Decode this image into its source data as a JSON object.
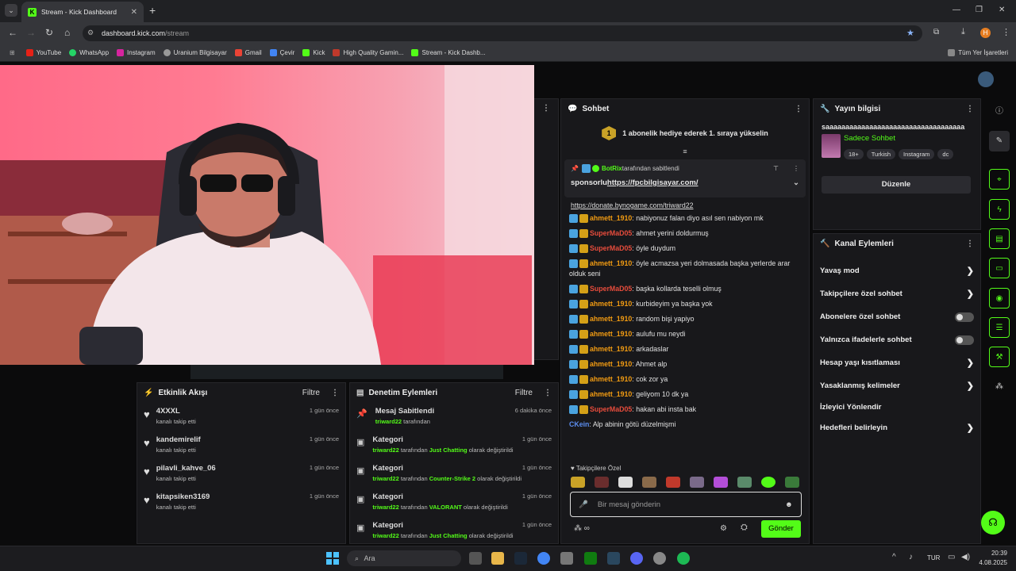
{
  "browser": {
    "tab_title": "Stream - Kick Dashboard",
    "url_host": "dashboard.kick.com",
    "url_path": "/stream",
    "bookmarks": [
      "YouTube",
      "WhatsApp",
      "Instagram",
      "Uranium Bilgisayar",
      "Gmail",
      "Çevir",
      "Kick",
      "High Quality Gamin...",
      "Stream - Kick Dashb..."
    ],
    "bookmarks_right": "Tüm Yer İşaretleri",
    "profile_initial": "H"
  },
  "events": {
    "title": "Etkinlik Akışı",
    "filter": "Filtre",
    "items": [
      {
        "name": "4XXXL",
        "sub": "kanalı takip etti",
        "time": "1 gün önce"
      },
      {
        "name": "kandemirelif",
        "sub": "kanalı takip etti",
        "time": "1 gün önce"
      },
      {
        "name": "pilavli_kahve_06",
        "sub": "kanalı takip etti",
        "time": "1 gün önce"
      },
      {
        "name": "kitapsiken3169",
        "sub": "kanalı takip etti",
        "time": "1 gün önce"
      }
    ]
  },
  "moderation": {
    "title": "Denetim Eylemleri",
    "filter": "Filtre",
    "items": [
      {
        "title": "Mesaj Sabitlendi",
        "by": "triward22",
        "mid": " tarafından",
        "value": "",
        "end": "",
        "time": "6 dakika önce"
      },
      {
        "title": "Kategori",
        "by": "triward22",
        "mid": " tarafından ",
        "value": "Just Chatting",
        "end": " olarak değiştirildi",
        "time": "1 gün önce"
      },
      {
        "title": "Kategori",
        "by": "triward22",
        "mid": " tarafından ",
        "value": "Counter-Strike 2",
        "end": " olarak değiştirildi",
        "time": "1 gün önce"
      },
      {
        "title": "Kategori",
        "by": "triward22",
        "mid": " tarafından ",
        "value": "VALORANT",
        "end": " olarak değiştirildi",
        "time": "1 gün önce"
      },
      {
        "title": "Kategori",
        "by": "triward22",
        "mid": " tarafından ",
        "value": "Just Chatting",
        "end": " olarak değiştirildi",
        "time": "1 gün önce"
      }
    ]
  },
  "chat": {
    "title": "Sohbet",
    "gift_banner": "1 abonelik hediye ederek 1. sıraya yükselin",
    "gift_rank": "1",
    "pinned_by": "BotRix",
    "pinned_by_suffix": " tarafından sabitlendi",
    "pinned_prefix": "sponsorlu ",
    "pinned_link": "https://fpcbilgisayar.com/",
    "first_line": "https://donate.bynogame.com/triward22",
    "messages": [
      {
        "user": "ahmett_1910",
        "color": "or",
        "text": "nabiyonuz falan diyo asıl sen nabiyon mk"
      },
      {
        "user": "SuperMaD05",
        "color": "rd",
        "text": "ahmet yerini doldurmuş"
      },
      {
        "user": "SuperMaD05",
        "color": "rd",
        "text": "öyle duydum"
      },
      {
        "user": "ahmett_1910",
        "color": "or",
        "text": "öyle acmazsa yeri dolmasada başka yerlerde arar olduk seni"
      },
      {
        "user": "SuperMaD05",
        "color": "rd",
        "text": "başka kollarda teselli olmuş"
      },
      {
        "user": "ahmett_1910",
        "color": "or",
        "text": "kurbideyim ya başka yok"
      },
      {
        "user": "ahmett_1910",
        "color": "or",
        "text": "random bişi yapiyo"
      },
      {
        "user": "ahmett_1910",
        "color": "or",
        "text": "aulufu mu neydi"
      },
      {
        "user": "ahmett_1910",
        "color": "or",
        "text": "arkadaslar"
      },
      {
        "user": "ahmett_1910",
        "color": "or",
        "text": "Ahmet alp"
      },
      {
        "user": "ahmett_1910",
        "color": "or",
        "text": "cok zor ya"
      },
      {
        "user": "ahmett_1910",
        "color": "or",
        "text": "geliyom 10 dk ya"
      },
      {
        "user": "SuperMaD05",
        "color": "rd",
        "text": "hakan abi insta bak"
      },
      {
        "user": "CKein",
        "color": "bl",
        "text": "Alp abinin götü düzelmişmi",
        "nobadge": true
      }
    ],
    "emote_label": "Takipçilere Özel",
    "input_placeholder": "Bir mesaj gönderin",
    "send": "Gönder"
  },
  "stream_info": {
    "title": "Yayın bilgisi",
    "stream_title": "saaaaaaaaaaaaaaaaaaaaaaaaaaaaaaaaaaa",
    "category": "Sadece Sohbet",
    "tags": [
      "18+",
      "Turkish",
      "Instagram",
      "dc"
    ],
    "edit": "Düzenle"
  },
  "channel_actions": {
    "title": "Kanal Eylemleri",
    "items": [
      {
        "label": "Yavaş mod",
        "control": "chevron"
      },
      {
        "label": "Takipçilere özel sohbet",
        "control": "chevron"
      },
      {
        "label": "Abonelere özel sohbet",
        "control": "toggle"
      },
      {
        "label": "Yalnızca ifadelerle sohbet",
        "control": "toggle"
      },
      {
        "label": "Hesap yaşı kısıtlaması",
        "control": "chevron"
      },
      {
        "label": "Yasaklanmış kelimeler",
        "control": "chevron"
      },
      {
        "label": "İzleyici Yönlendir",
        "control": "none"
      },
      {
        "label": "Hedefleri belirleyin",
        "control": "chevron"
      }
    ]
  },
  "taskbar": {
    "search": "Ara",
    "lang": "TUR",
    "time": "20:39",
    "date": "4.08.2025"
  },
  "colors": {
    "accent": "#53fc18",
    "panel": "#18181b"
  }
}
